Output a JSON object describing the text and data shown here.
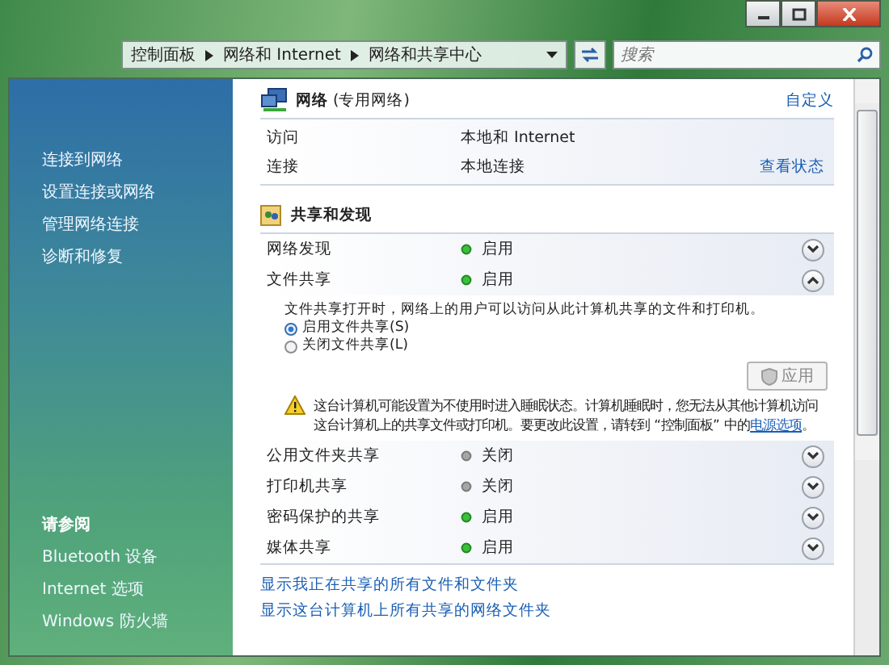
{
  "breadcrumb": [
    "控制面板",
    "网络和 Internet",
    "网络和共享中心"
  ],
  "search": {
    "placeholder": "搜索"
  },
  "sidebar": {
    "tasks": [
      "连接到网络",
      "设置连接或网络",
      "管理网络连接",
      "诊断和修复"
    ],
    "see_also_title": "请参阅",
    "see_also": [
      "Bluetooth 设备",
      "Internet 选项",
      "Windows 防火墙"
    ]
  },
  "network": {
    "name": "网络",
    "type": "(专用网络)",
    "customize": "自定义",
    "rows": [
      {
        "label": "访问",
        "value": "本地和 Internet"
      },
      {
        "label": "连接",
        "value": "本地连接",
        "action": "查看状态"
      }
    ]
  },
  "sharing": {
    "title": "共享和发现",
    "settings": [
      {
        "label": "网络发现",
        "status": "启用",
        "on": true,
        "expanded": false
      },
      {
        "label": "文件共享",
        "status": "启用",
        "on": true,
        "expanded": true,
        "detail": {
          "description": "文件共享打开时，网络上的用户可以访问从此计算机共享的文件和打印机。",
          "options": [
            {
              "label": "启用文件共享(S)",
              "selected": true
            },
            {
              "label": "关闭文件共享(L)",
              "selected": false
            }
          ],
          "apply": {
            "label": "应用",
            "disabled": true
          },
          "warning": "这台计算机可能设置为不使用时进入睡眠状态。计算机睡眠时，您无法从其他计算机访问这台计算机上的共享文件或打印机。要更改此设置，请转到 “控制面板” 中的",
          "warning_link": "电源选项",
          "warning_end": "。"
        }
      },
      {
        "label": "公用文件夹共享",
        "status": "关闭",
        "on": false,
        "expanded": false
      },
      {
        "label": "打印机共享",
        "status": "关闭",
        "on": false,
        "expanded": false
      },
      {
        "label": "密码保护的共享",
        "status": "启用",
        "on": true,
        "expanded": false
      },
      {
        "label": "媒体共享",
        "status": "启用",
        "on": true,
        "expanded": false
      }
    ]
  },
  "links": [
    "显示我正在共享的所有文件和文件夹",
    "显示这台计算机上所有共享的网络文件夹"
  ]
}
